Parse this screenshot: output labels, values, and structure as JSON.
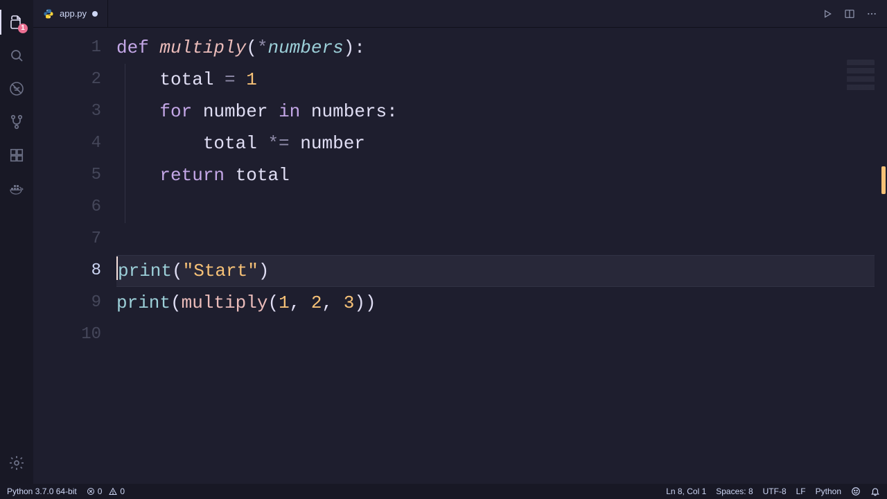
{
  "activity": {
    "explorer_badge": "1"
  },
  "tab": {
    "filename": "app.py"
  },
  "editor": {
    "current_line_index": 7,
    "line_numbers": [
      "1",
      "2",
      "3",
      "4",
      "5",
      "6",
      "7",
      "8",
      "9",
      "10"
    ],
    "tokens": {
      "l1": {
        "def": "def",
        "sp": " ",
        "fn": "multiply",
        "lp": "(",
        "star": "*",
        "param": "numbers",
        "rp": ")",
        "colon": ":"
      },
      "l2": {
        "indent": "    ",
        "var": "total",
        "sp": " ",
        "eq": "=",
        "sp2": " ",
        "num": "1"
      },
      "l3": {
        "indent": "    ",
        "for": "for",
        "sp": " ",
        "v": "number",
        "sp2": " ",
        "in": "in",
        "sp3": " ",
        "it": "numbers",
        "colon": ":"
      },
      "l4": {
        "indent": "        ",
        "v": "total",
        "sp": " ",
        "op": "*=",
        "sp2": " ",
        "v2": "number"
      },
      "l5": {
        "indent": "    ",
        "ret": "return",
        "sp": " ",
        "v": "total"
      },
      "l8": {
        "fn": "print",
        "lp": "(",
        "str": "\"Start\"",
        "rp": ")"
      },
      "l9": {
        "fn": "print",
        "lp": "(",
        "call": "multiply",
        "lp2": "(",
        "n1": "1",
        "c1": ", ",
        "n2": "2",
        "c2": ", ",
        "n3": "3",
        "rp2": ")",
        "rp": ")"
      }
    }
  },
  "status": {
    "interpreter": "Python 3.7.0 64-bit",
    "errors": "0",
    "warnings": "0",
    "cursor": "Ln 8, Col 1",
    "indent": "Spaces: 8",
    "encoding": "UTF-8",
    "eol": "LF",
    "language": "Python"
  }
}
